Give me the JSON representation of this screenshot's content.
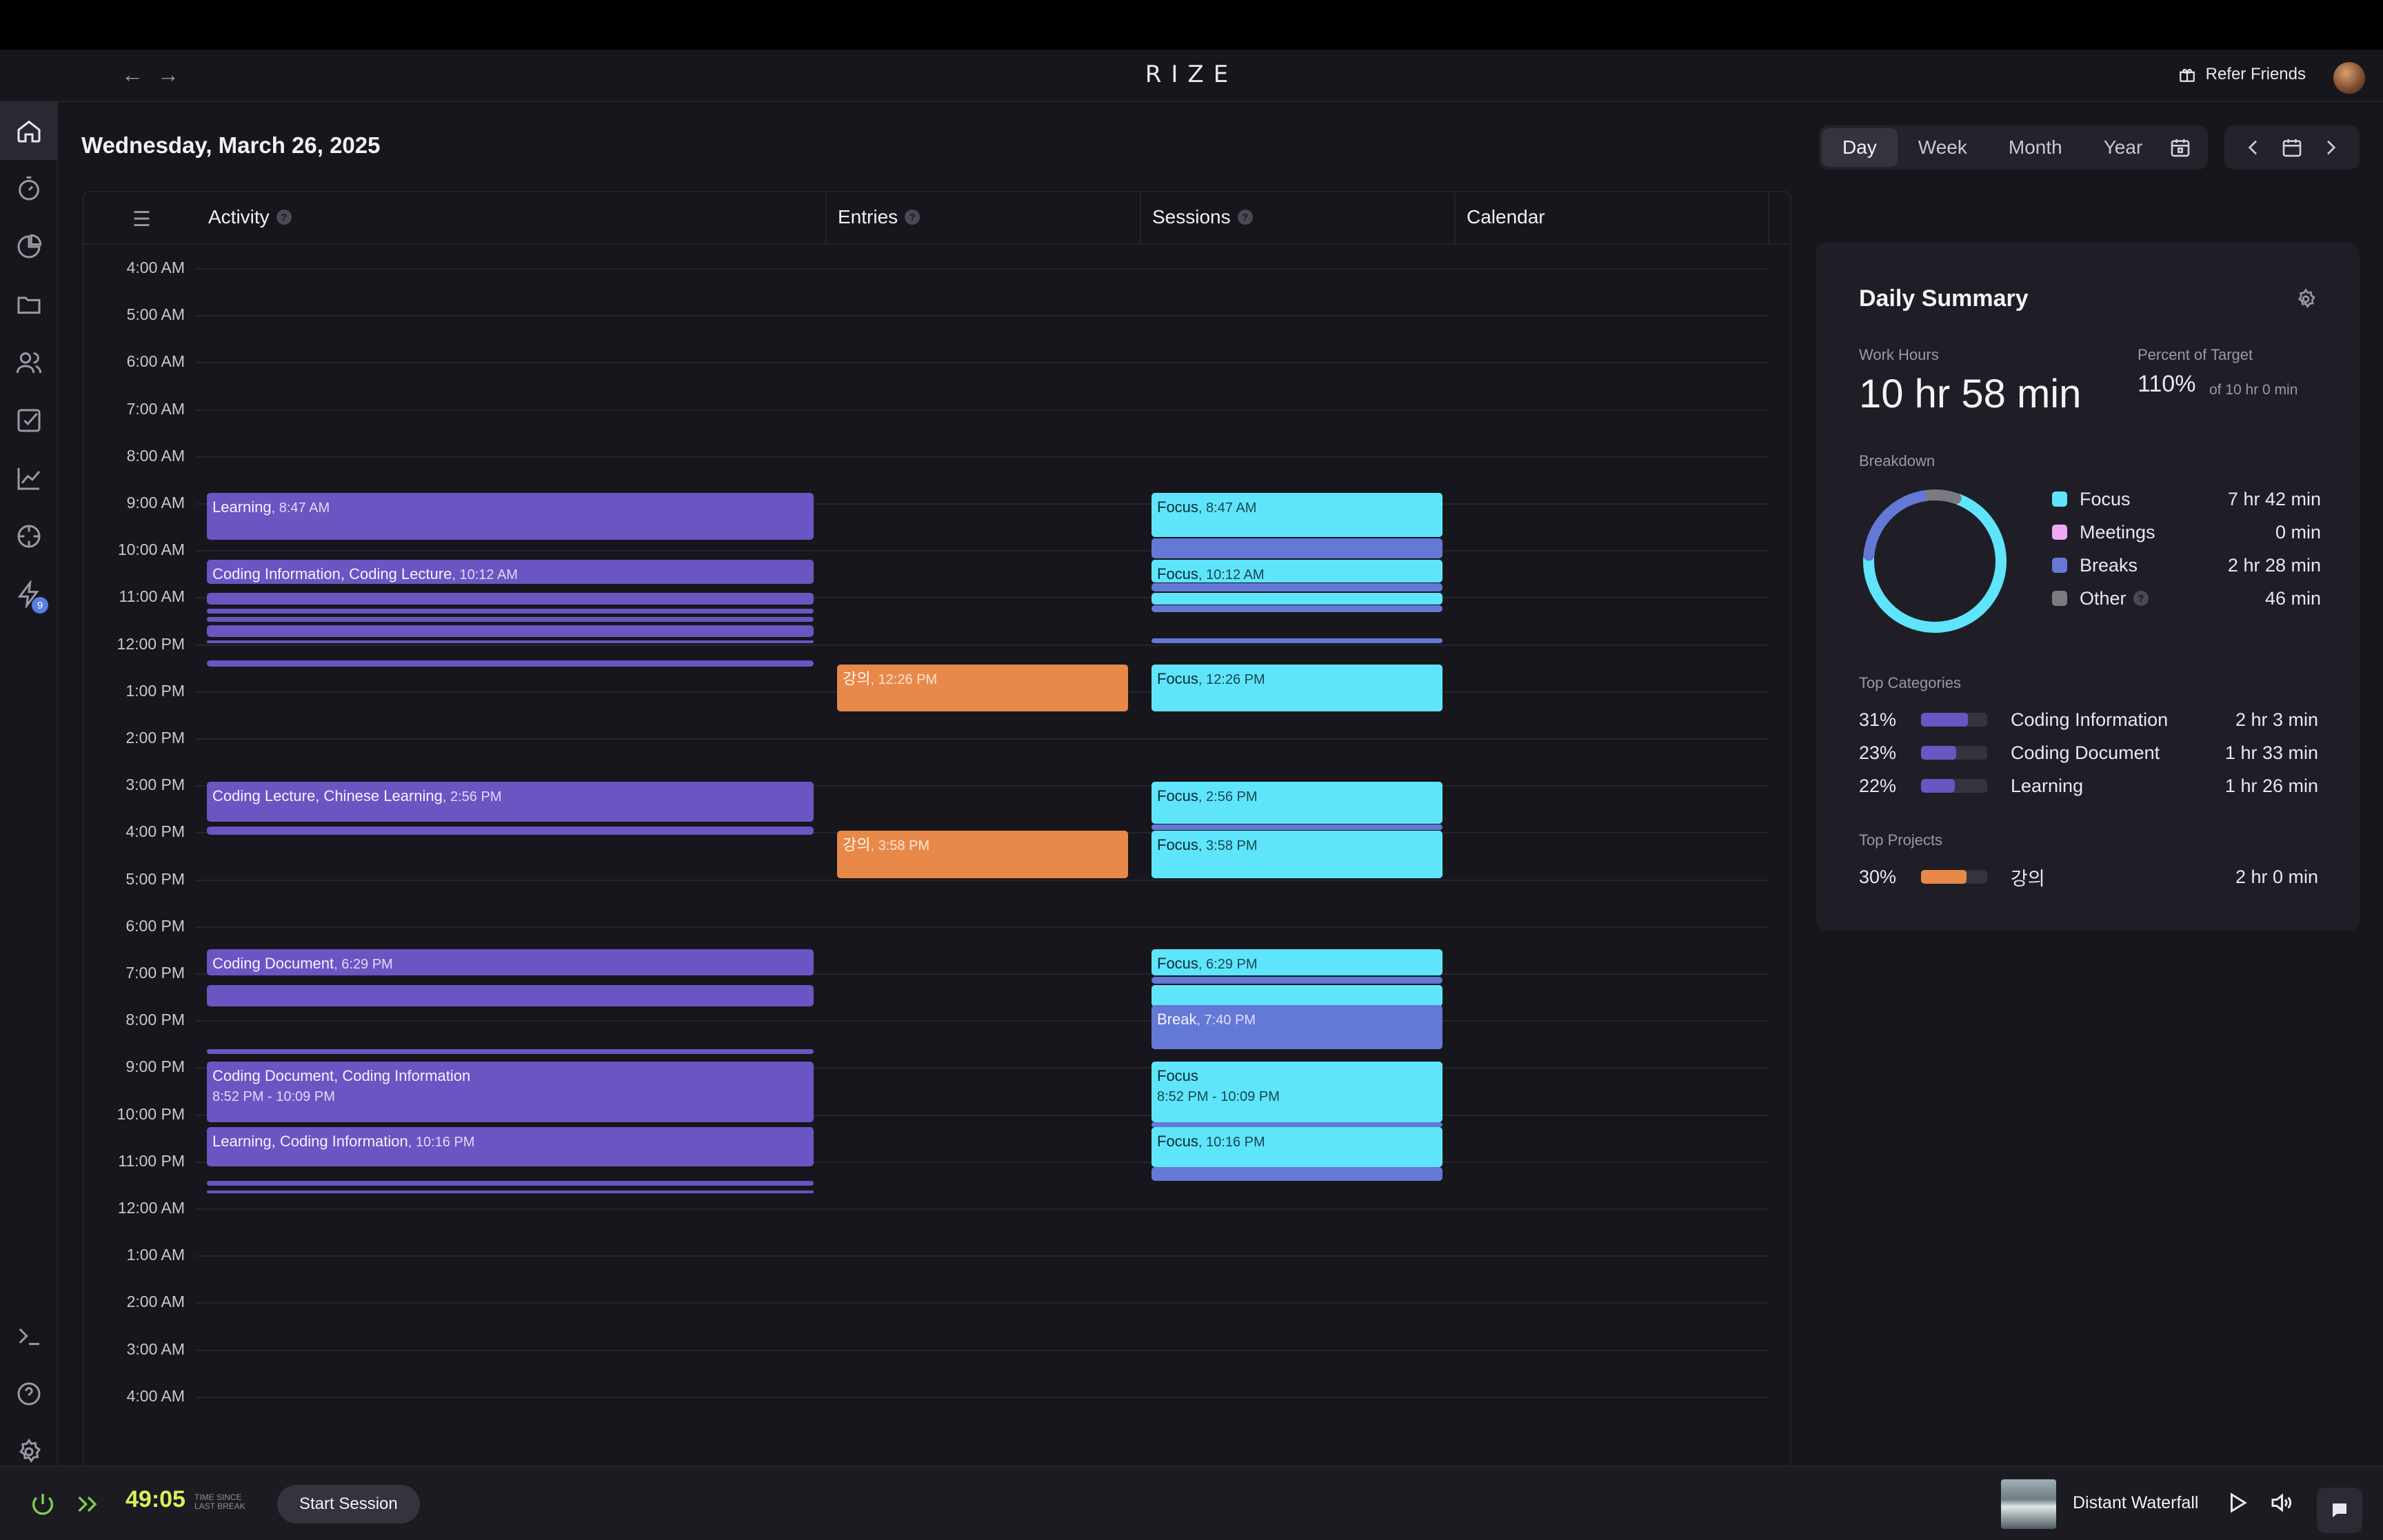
{
  "titlebar": {
    "brand": "RIZE",
    "back_icon": "arrow-left-icon",
    "forward_icon": "arrow-right-icon",
    "refer_label": "Refer Friends",
    "refer_icon": "gift-icon"
  },
  "sidebar": {
    "items": [
      {
        "icon": "home-icon",
        "active": true
      },
      {
        "icon": "timer-icon"
      },
      {
        "icon": "pie-chart-icon"
      },
      {
        "icon": "folder-icon"
      },
      {
        "icon": "users-icon"
      },
      {
        "icon": "checkbox-icon"
      },
      {
        "icon": "trend-chart-icon"
      },
      {
        "icon": "target-icon"
      },
      {
        "icon": "bolt-icon",
        "badge": "9"
      }
    ],
    "bottom_items": [
      {
        "icon": "terminal-icon"
      },
      {
        "icon": "help-icon"
      },
      {
        "icon": "settings-icon"
      }
    ]
  },
  "header": {
    "date": "Wednesday, March 26, 2025",
    "ranges": [
      "Day",
      "Week",
      "Month",
      "Year"
    ],
    "active_range": "Day"
  },
  "timeline": {
    "columns": [
      "Activity",
      "Entries",
      "Sessions",
      "Calendar"
    ],
    "hours": [
      "4:00 AM",
      "5:00 AM",
      "6:00 AM",
      "7:00 AM",
      "8:00 AM",
      "9:00 AM",
      "10:00 AM",
      "11:00 AM",
      "12:00 PM",
      "1:00 PM",
      "2:00 PM",
      "3:00 PM",
      "4:00 PM",
      "5:00 PM",
      "6:00 PM",
      "7:00 PM",
      "8:00 PM",
      "9:00 PM",
      "10:00 PM",
      "11:00 PM",
      "12:00 AM",
      "1:00 AM",
      "2:00 AM",
      "3:00 AM",
      "4:00 AM"
    ],
    "activity_blocks": [
      {
        "title": "Learning",
        "sub": ", 8:47 AM",
        "start": 8.78,
        "end": 9.78
      },
      {
        "title": "Coding Information, Coding Lecture",
        "sub": ", 10:12 AM",
        "start": 10.2,
        "end": 10.72
      },
      {
        "title": "",
        "sub": "",
        "start": 10.9,
        "end": 11.15
      },
      {
        "title": "",
        "sub": "",
        "start": 11.25,
        "end": 11.35
      },
      {
        "title": "",
        "sub": "",
        "start": 11.42,
        "end": 11.52
      },
      {
        "title": "",
        "sub": "",
        "start": 11.6,
        "end": 11.85
      },
      {
        "title": "",
        "sub": "",
        "start": 11.92,
        "end": 11.98
      },
      {
        "title": "",
        "sub": "",
        "start": 12.35,
        "end": 12.48
      },
      {
        "title": "Coding Lecture, Chinese Learning",
        "sub": ", 2:56 PM",
        "start": 14.93,
        "end": 15.78
      },
      {
        "title": "",
        "sub": "",
        "start": 15.88,
        "end": 16.05
      },
      {
        "title": "Coding Document",
        "sub": ", 6:29 PM",
        "start": 18.48,
        "end": 19.05
      },
      {
        "title": "",
        "sub": "",
        "start": 19.25,
        "end": 19.7
      },
      {
        "title": "",
        "sub": "",
        "start": 20.62,
        "end": 20.72
      },
      {
        "title": "Coding Document, Coding Information",
        "sub2": "8:52 PM - 10:09 PM",
        "start": 20.87,
        "end": 22.17
      },
      {
        "title": "Learning, Coding Information",
        "sub": ", 10:16 PM",
        "start": 22.27,
        "end": 23.1
      },
      {
        "title": "",
        "sub": "",
        "start": 23.42,
        "end": 23.52
      },
      {
        "title": "",
        "sub": "",
        "start": 23.62,
        "end": 23.68
      }
    ],
    "entry_blocks": [
      {
        "title": "강의",
        "sub": ", 12:26 PM",
        "start": 12.43,
        "end": 13.43
      },
      {
        "title": "강의",
        "sub": ", 3:58 PM",
        "start": 15.97,
        "end": 16.97
      }
    ],
    "session_blocks": [
      {
        "kind": "ses",
        "title": "Focus",
        "sub": ", 8:47 AM",
        "start": 8.78,
        "end": 9.72
      },
      {
        "kind": "brk",
        "title": "",
        "sub": "",
        "start": 9.75,
        "end": 10.18
      },
      {
        "kind": "ses",
        "title": "Focus",
        "sub": ", 10:12 AM",
        "start": 10.2,
        "end": 10.68
      },
      {
        "kind": "brk",
        "title": "",
        "sub": "",
        "start": 10.7,
        "end": 10.88
      },
      {
        "kind": "ses",
        "title": "",
        "sub": "",
        "start": 10.9,
        "end": 11.15
      },
      {
        "kind": "brk",
        "title": "",
        "sub": "",
        "start": 11.17,
        "end": 11.32
      },
      {
        "kind": "brk",
        "title": "",
        "sub": "",
        "start": 11.88,
        "end": 11.98
      },
      {
        "kind": "ses",
        "title": "Focus",
        "sub": ", 12:26 PM",
        "start": 12.43,
        "end": 13.43
      },
      {
        "kind": "ses",
        "title": "Focus",
        "sub": ", 2:56 PM",
        "start": 14.93,
        "end": 15.82
      },
      {
        "kind": "brk",
        "title": "",
        "sub": "",
        "start": 15.84,
        "end": 15.95
      },
      {
        "kind": "ses",
        "title": "Focus",
        "sub": ", 3:58 PM",
        "start": 15.97,
        "end": 16.97
      },
      {
        "kind": "ses",
        "title": "Focus",
        "sub": ", 6:29 PM",
        "start": 18.48,
        "end": 19.05
      },
      {
        "kind": "brk",
        "title": "",
        "sub": "",
        "start": 19.07,
        "end": 19.22
      },
      {
        "kind": "ses",
        "title": "",
        "sub": "",
        "start": 19.25,
        "end": 19.7
      },
      {
        "kind": "brk",
        "title": "Break",
        "sub": ", 7:40 PM",
        "start": 19.67,
        "end": 20.62
      },
      {
        "kind": "ses",
        "title": "Focus",
        "sub2": "8:52 PM - 10:09 PM",
        "start": 20.87,
        "end": 22.17
      },
      {
        "kind": "brk",
        "title": "",
        "sub": "",
        "start": 22.17,
        "end": 22.27
      },
      {
        "kind": "ses",
        "title": "Focus",
        "sub": ", 10:16 PM",
        "start": 22.27,
        "end": 23.12
      },
      {
        "kind": "brk",
        "title": "",
        "sub": "",
        "start": 23.12,
        "end": 23.42
      }
    ]
  },
  "summary": {
    "title": "Daily Summary",
    "work_hours_label": "Work Hours",
    "work_hours": "10 hr 58 min",
    "percent_label": "Percent of Target",
    "percent": "110%",
    "percent_of": "of 10 hr 0 min",
    "breakdown_label": "Breakdown",
    "breakdown": [
      {
        "name": "Focus",
        "value": "7 hr 42 min",
        "color": "#5fe5fb",
        "minutes": 462
      },
      {
        "name": "Meetings",
        "value": "0 min",
        "color": "#f0a8f5",
        "minutes": 0
      },
      {
        "name": "Breaks",
        "value": "2 hr 28 min",
        "color": "#6478d6",
        "minutes": 148
      },
      {
        "name": "Other",
        "value": "46 min",
        "color": "#7a7a80",
        "minutes": 46,
        "help": true
      }
    ],
    "top_categories_label": "Top Categories",
    "top_categories": [
      {
        "pct": "31%",
        "name": "Coding Information",
        "value": "2 hr 3 min",
        "fill": 0.31,
        "color": "#6a55c2"
      },
      {
        "pct": "23%",
        "name": "Coding Document",
        "value": "1 hr 33 min",
        "fill": 0.23,
        "color": "#6a55c2"
      },
      {
        "pct": "22%",
        "name": "Learning",
        "value": "1 hr 26 min",
        "fill": 0.22,
        "color": "#6a55c2"
      }
    ],
    "top_projects_label": "Top Projects",
    "top_projects": [
      {
        "pct": "30%",
        "name": "강의",
        "value": "2 hr 0 min",
        "fill": 0.3,
        "color": "#e8894a"
      }
    ]
  },
  "bottombar": {
    "timer": "49:05",
    "timer_caption_1": "TIME SINCE",
    "timer_caption_2": "LAST BREAK",
    "start_label": "Start Session",
    "music_title": "Distant Waterfall"
  },
  "help_glyph": "?"
}
